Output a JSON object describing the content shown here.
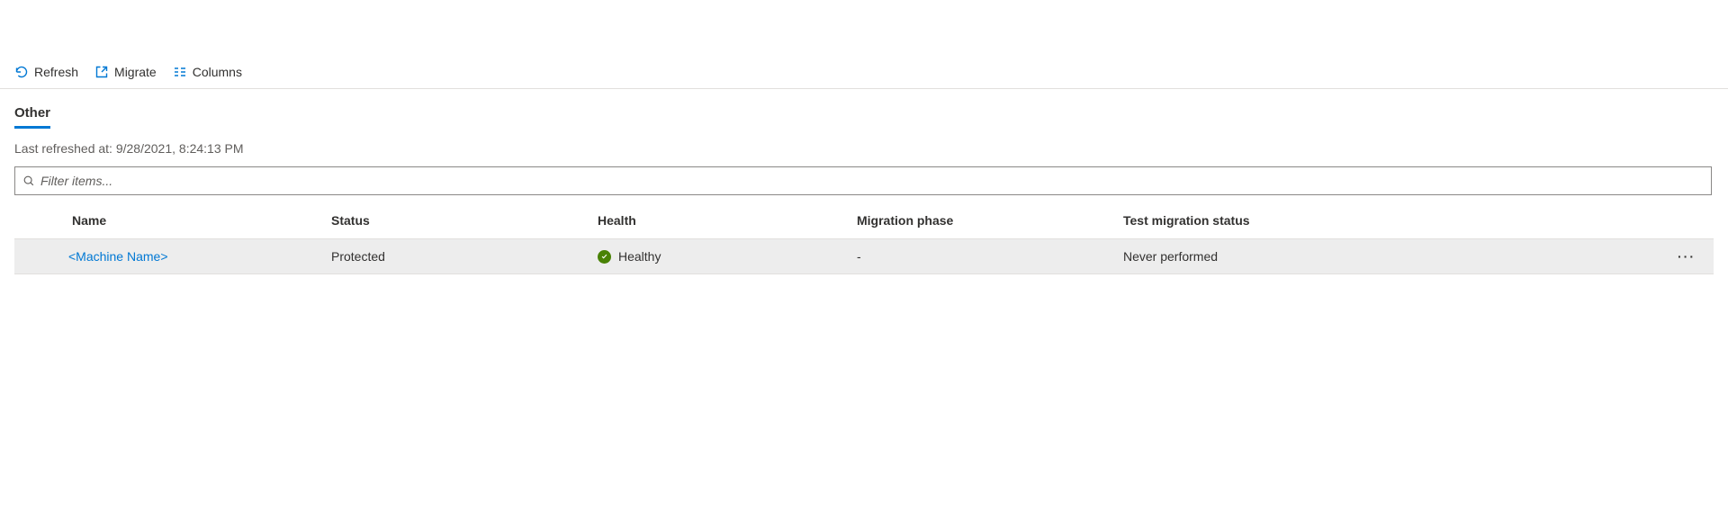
{
  "toolbar": {
    "refresh_label": "Refresh",
    "migrate_label": "Migrate",
    "columns_label": "Columns"
  },
  "tabs": {
    "active": "Other"
  },
  "meta": {
    "last_refreshed_prefix": "Last refreshed at: ",
    "last_refreshed_value": "9/28/2021, 8:24:13 PM"
  },
  "filter": {
    "placeholder": "Filter items..."
  },
  "columns": {
    "name": "Name",
    "status": "Status",
    "health": "Health",
    "migration_phase": "Migration phase",
    "test_migration_status": "Test migration status"
  },
  "rows": [
    {
      "name": "<Machine Name>",
      "status": "Protected",
      "health": "Healthy",
      "migration_phase": "-",
      "test_migration_status": "Never performed"
    }
  ],
  "icons": {
    "refresh": "refresh-icon",
    "migrate": "external-link-icon",
    "columns": "columns-icon",
    "search": "search-icon",
    "health_ok": "check-circle-icon",
    "more": "more-icon"
  },
  "colors": {
    "accent": "#0078d4",
    "health_ok": "#498205"
  }
}
